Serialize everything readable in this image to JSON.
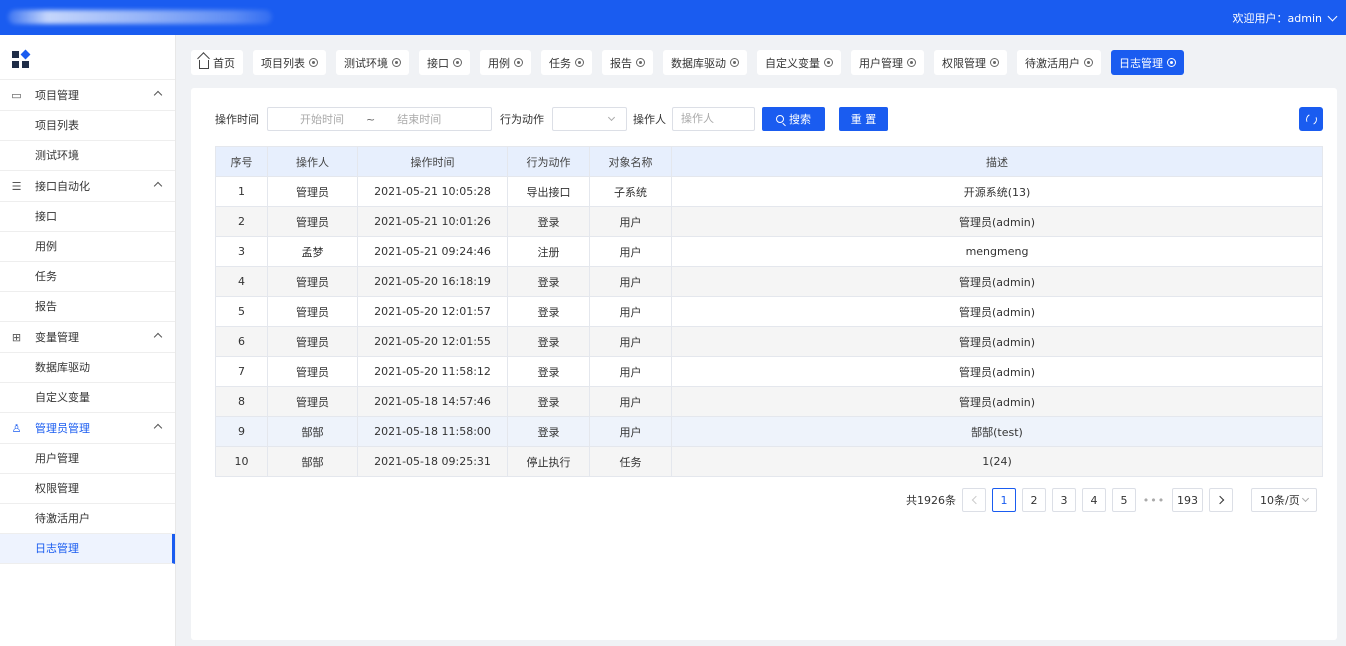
{
  "header": {
    "welcome": "欢迎用户：admin"
  },
  "sidebar": {
    "groups": [
      {
        "label": "项目管理",
        "icon": "folder-icon",
        "items": [
          "项目列表",
          "测试环境"
        ]
      },
      {
        "label": "接口自动化",
        "icon": "sliders-icon",
        "items": [
          "接口",
          "用例",
          "任务",
          "报告"
        ]
      },
      {
        "label": "变量管理",
        "icon": "hierarchy-icon",
        "items": [
          "数据库驱动",
          "自定义变量"
        ]
      },
      {
        "label": "管理员管理",
        "icon": "user-icon",
        "items": [
          "用户管理",
          "权限管理",
          "待激活用户",
          "日志管理"
        ]
      }
    ]
  },
  "tabs": [
    "首页",
    "项目列表",
    "测试环境",
    "接口",
    "用例",
    "任务",
    "报告",
    "数据库驱动",
    "自定义变量",
    "用户管理",
    "权限管理",
    "待激活用户",
    "日志管理"
  ],
  "filters": {
    "time_label": "操作时间",
    "start_placeholder": "开始时间",
    "range_sep": "~",
    "end_placeholder": "结束时间",
    "action_label": "行为动作",
    "operator_label": "操作人",
    "operator_placeholder": "操作人",
    "search_label": "搜索",
    "reset_label": "重 置"
  },
  "table": {
    "columns": [
      "序号",
      "操作人",
      "操作时间",
      "行为动作",
      "对象名称",
      "描述"
    ],
    "rows": [
      [
        "1",
        "管理员",
        "2021-05-21 10:05:28",
        "导出接口",
        "子系统",
        "开源系统(13)"
      ],
      [
        "2",
        "管理员",
        "2021-05-21 10:01:26",
        "登录",
        "用户",
        "管理员(admin)"
      ],
      [
        "3",
        "孟梦",
        "2021-05-21 09:24:46",
        "注册",
        "用户",
        "mengmeng"
      ],
      [
        "4",
        "管理员",
        "2021-05-20 16:18:19",
        "登录",
        "用户",
        "管理员(admin)"
      ],
      [
        "5",
        "管理员",
        "2021-05-20 12:01:57",
        "登录",
        "用户",
        "管理员(admin)"
      ],
      [
        "6",
        "管理员",
        "2021-05-20 12:01:55",
        "登录",
        "用户",
        "管理员(admin)"
      ],
      [
        "7",
        "管理员",
        "2021-05-20 11:58:12",
        "登录",
        "用户",
        "管理员(admin)"
      ],
      [
        "8",
        "管理员",
        "2021-05-18 14:57:46",
        "登录",
        "用户",
        "管理员(admin)"
      ],
      [
        "9",
        "郜郜",
        "2021-05-18 11:58:00",
        "登录",
        "用户",
        "郜郜(test)"
      ],
      [
        "10",
        "郜郜",
        "2021-05-18 09:25:31",
        "停止执行",
        "任务",
        "1(24)"
      ]
    ]
  },
  "pagination": {
    "total": "共1926条",
    "pages": [
      "1",
      "2",
      "3",
      "4",
      "5"
    ],
    "ellipsis": "•••",
    "last": "193",
    "page_size": "10条/页"
  }
}
